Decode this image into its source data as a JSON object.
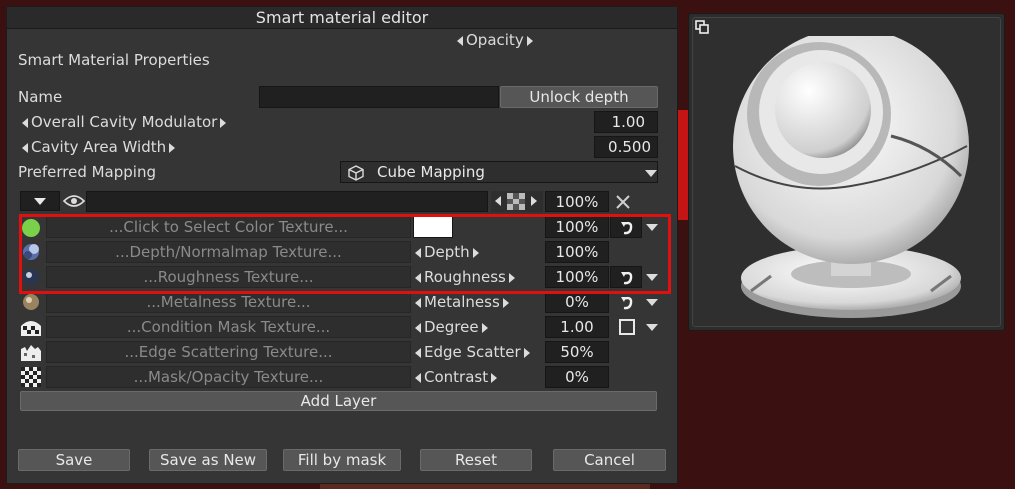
{
  "dialog": {
    "title": "Smart material editor",
    "section_title": "Smart Material Properties",
    "name_label": "Name",
    "name_value": "",
    "unlock_depth": "Unlock depth",
    "overall_cavity_label": "Overall Cavity Modulator",
    "overall_cavity_value": "1.00",
    "cavity_width_label": "Cavity Area Width",
    "cavity_width_value": "0.500",
    "preferred_mapping_label": "Preferred Mapping",
    "preferred_mapping_value": "Cube Mapping",
    "layer_header_value": "100%",
    "add_layer": "Add Layer"
  },
  "layers": [
    {
      "texture": "...Click to Select Color Texture...",
      "param": "Opacity",
      "value": "100%"
    },
    {
      "texture": "...Depth/Normalmap Texture...",
      "param": "Depth",
      "value": "100%"
    },
    {
      "texture": "...Roughness Texture...",
      "param": "Roughness",
      "value": "100%"
    },
    {
      "texture": "...Metalness Texture...",
      "param": "Metalness",
      "value": "0%"
    },
    {
      "texture": "...Condition Mask Texture...",
      "param": "Degree",
      "value": "1.00"
    },
    {
      "texture": "...Edge Scattering Texture...",
      "param": "Edge Scatter",
      "value": "50%"
    },
    {
      "texture": "...Mask/Opacity Texture...",
      "param": "Contrast",
      "value": "0%"
    }
  ],
  "footer": {
    "save": "Save",
    "save_as_new": "Save as New",
    "fill_by_mask": "Fill by mask",
    "reset": "Reset",
    "cancel": "Cancel"
  },
  "colors": {
    "color_swatch": "#ffffff",
    "layer_color_icon": "#7ad04a",
    "highlight": "#e01010"
  }
}
